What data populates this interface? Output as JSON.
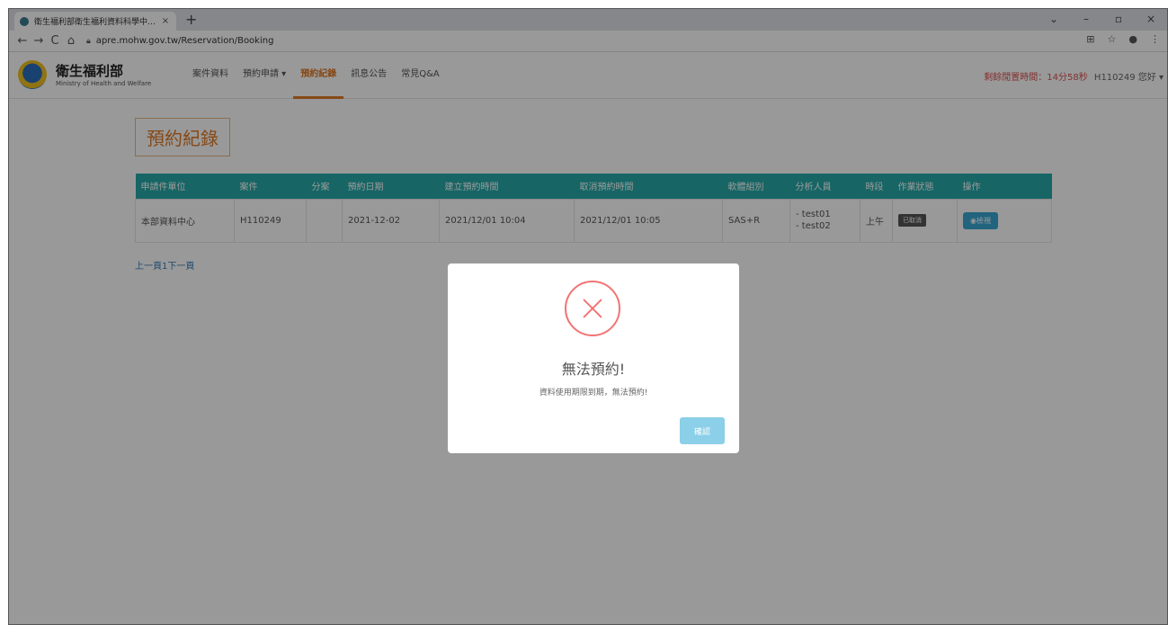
{
  "browser": {
    "tab_title": "衛生福利部衛生福利資料科學中…",
    "tab_close": "×",
    "new_tab": "+",
    "url": "apre.mohw.gov.tw/Reservation/Booking",
    "back": "←",
    "forward": "→",
    "reload": "C",
    "home": "⌂",
    "win_chevron": "⌄",
    "win_minimize": "–",
    "win_restore": "▫",
    "win_close": "×"
  },
  "site": {
    "name": "衛生福利部",
    "name_en": "Ministry of Health and Welfare",
    "nav": [
      "案件資料",
      "預約申請 ▾",
      "預約紀錄",
      "訊息公告",
      "常見Q&A"
    ],
    "session_label": "剩餘閒置時間：",
    "session_timer": "14分58秒",
    "user_greeting": "H110249 您好 ▾"
  },
  "page": {
    "title": "預約紀錄",
    "table_headers": [
      "申請件單位",
      "案件",
      "分案",
      "預約日期",
      "建立預約時間",
      "取消預約時間",
      "軟體組別",
      "分析人員",
      "時段",
      "作業狀態",
      "操作"
    ],
    "row": {
      "unit": "本部資料中心",
      "case": "H110249",
      "sub_case": "",
      "date": "2021-12-02",
      "created": "2021/12/01 10:04",
      "cancelled": "2021/12/01 10:05",
      "software": "SAS+R",
      "analyst1": "- test01",
      "analyst2": "- test02",
      "period": "上午",
      "status": "已取消",
      "action": "◉檢視"
    },
    "pager": "上一頁1下一頁"
  },
  "modal": {
    "title": "無法預約!",
    "message": "資料使用期限到期，無法預約!",
    "confirm": "確認"
  }
}
